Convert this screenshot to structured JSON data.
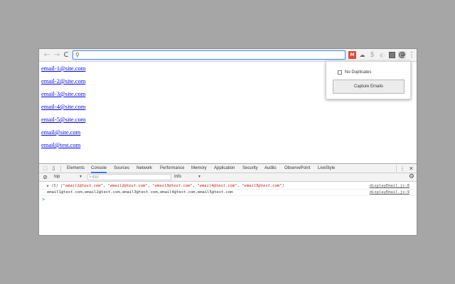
{
  "toolbar": {
    "back_glyph": "←",
    "forward_glyph": "→",
    "reload_glyph": "C",
    "search_glyph": "⚲",
    "url_value": "",
    "extensions": [
      {
        "name": "gmail-extension-icon",
        "glyph": "M"
      },
      {
        "name": "cloud-extension-icon",
        "glyph": "☁"
      },
      {
        "name": "dollar-extension-icon",
        "glyph": "$"
      },
      {
        "name": "shield-extension-icon",
        "glyph": "◐"
      },
      {
        "name": "box-extension-icon",
        "glyph": ""
      },
      {
        "name": "email-extractor-extension-icon",
        "glyph": "@"
      }
    ],
    "menu_glyph": "⋮"
  },
  "page": {
    "emails": [
      "email-1@site.com",
      "email-2@site.com",
      "email-3@site.com",
      "email-4@site.com",
      "email-5@site.com",
      "email@site.com",
      "email@test.com"
    ]
  },
  "popup": {
    "checkbox_label": "No Duplicates",
    "button_label": "Capture Emails"
  },
  "devtools": {
    "inspect_glyph": "⬚",
    "device_glyph": "▯",
    "tabs": [
      "Elements",
      "Console",
      "Sources",
      "Network",
      "Performance",
      "Memory",
      "Application",
      "Security",
      "Audits",
      "ObservePoint",
      "LiveStyle"
    ],
    "selected_tab": "Console",
    "more_glyph": "⋮",
    "close_glyph": "✕",
    "clear_glyph": "⊘",
    "context": "top",
    "filter_placeholder": "Filter",
    "level": "Info",
    "gear_glyph": "⚙",
    "console": {
      "line1_prefix": "(5) [",
      "line1_items": [
        "\"email1@test.com\"",
        "\"email2@test.com\"",
        "\"email3@test.com\"",
        "\"email4@test.com\"",
        "\"email5@test.com\""
      ],
      "line1_suffix": "]",
      "line1_source": "displayEmail.js:8",
      "line2_text": "email1@test.com,email2@test.com,email3@test.com,email4@test.com,email5@test.com",
      "line2_source": "displayEmail.js:9",
      "prompt_glyph": ">"
    }
  }
}
